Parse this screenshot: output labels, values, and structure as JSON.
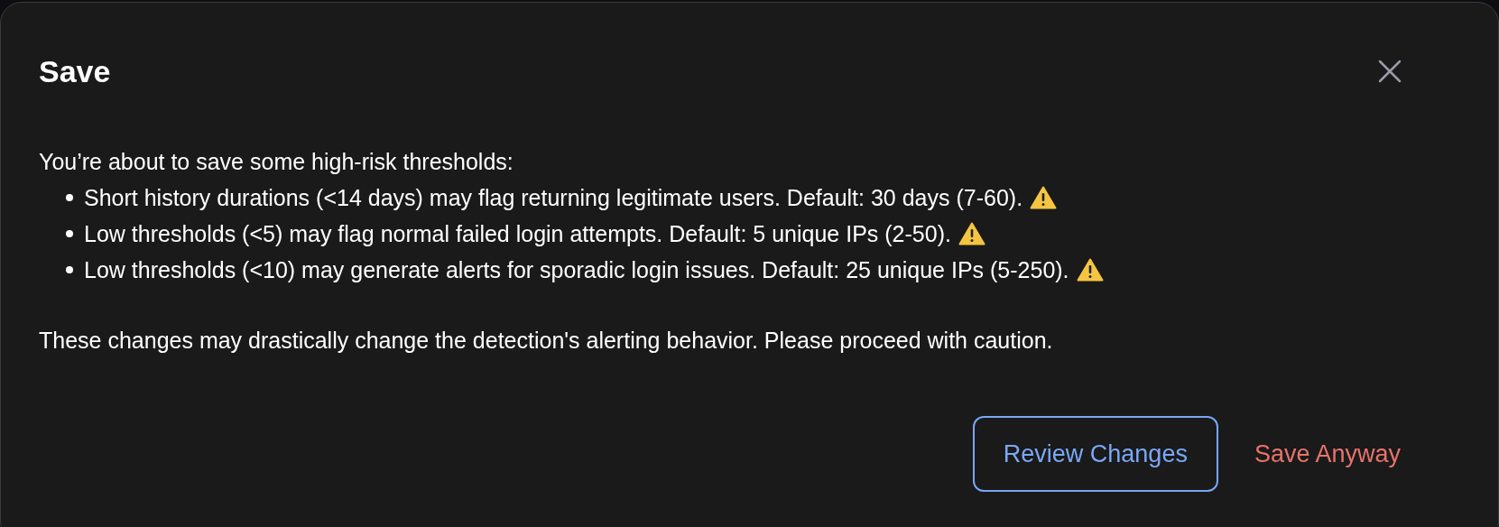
{
  "dialog": {
    "title": "Save",
    "intro": "You’re about to save some high-risk thresholds:",
    "warnings": [
      {
        "text": "Short history durations (<14 days) may flag returning legitimate users. Default: 30 days (7-60)."
      },
      {
        "text": "Low thresholds (<5) may flag normal failed login attempts. Default: 5 unique IPs (2-50)."
      },
      {
        "text": "Low thresholds (<10) may generate alerts for sporadic login issues. Default: 25 unique IPs (5-250)."
      }
    ],
    "note": "These changes may drastically change the detection's alerting behavior. Please proceed with caution.",
    "buttons": [
      {
        "label": "Review Changes",
        "kind": "outlined"
      },
      {
        "label": "Save Anyway",
        "kind": "danger"
      }
    ]
  }
}
